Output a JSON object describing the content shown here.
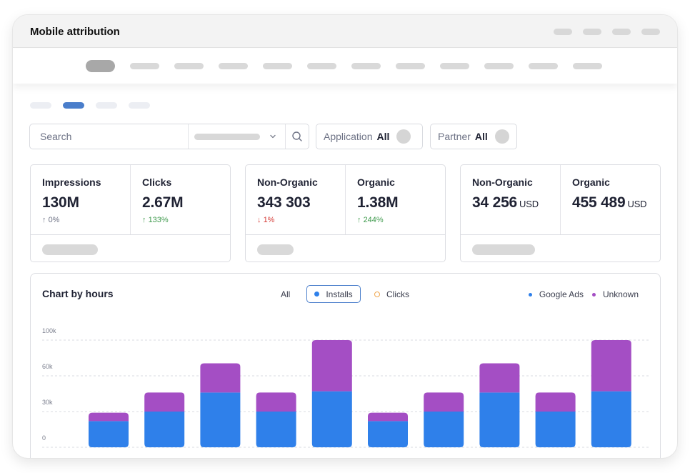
{
  "window": {
    "title": "Mobile attribution"
  },
  "search": {
    "placeholder": "Search"
  },
  "filters": [
    {
      "label": "Application",
      "value": "All"
    },
    {
      "label": "Partner",
      "value": "All"
    }
  ],
  "cards": [
    {
      "metrics": [
        {
          "label": "Impressions",
          "value": "130M",
          "unit": "",
          "delta": "0%",
          "direction": "neutral",
          "arrow": "↑"
        },
        {
          "label": "Clicks",
          "value": "2.67M",
          "unit": "",
          "delta": "133%",
          "direction": "up",
          "arrow": "↑"
        }
      ]
    },
    {
      "metrics": [
        {
          "label": "Non-Organic",
          "value": "343 303",
          "unit": "",
          "delta": "1%",
          "direction": "down",
          "arrow": "↓"
        },
        {
          "label": "Organic",
          "value": "1.38M",
          "unit": "",
          "delta": "244%",
          "direction": "up",
          "arrow": "↑"
        }
      ]
    },
    {
      "metrics": [
        {
          "label": "Non-Organic",
          "value": "34 256",
          "unit": "USD",
          "delta": "",
          "direction": "none",
          "arrow": ""
        },
        {
          "label": "Organic",
          "value": "455 489",
          "unit": "USD",
          "delta": "",
          "direction": "none",
          "arrow": ""
        }
      ]
    }
  ],
  "chart": {
    "title": "Chart by hours",
    "toggles": {
      "all": "All",
      "installs": "Installs",
      "clicks": "Clicks"
    },
    "legend": [
      {
        "label": "Google Ads",
        "color": "#2f80ea"
      },
      {
        "label": "Unknown",
        "color": "#a44ec4"
      }
    ]
  },
  "colors": {
    "accent": "#4a7ecb",
    "google_ads": "#2f80ea",
    "unknown": "#a44ec4",
    "clicks": "#f0a850",
    "up": "#3f9a4d",
    "down": "#d6403c"
  },
  "chart_data": {
    "type": "bar",
    "stacked": true,
    "title": "Chart by hours",
    "xlabel": "",
    "ylabel": "",
    "categories": [
      "",
      "",
      "",
      "",
      "",
      "",
      "",
      "",
      "",
      ""
    ],
    "yticks": [
      "0",
      "30k",
      "60k",
      "100k"
    ],
    "ytick_values": [
      0,
      30000,
      60000,
      100000
    ],
    "ylim": [
      0,
      100000
    ],
    "grid": true,
    "legend_position": "top-right",
    "series": [
      {
        "name": "Google Ads",
        "values": [
          22000,
          30000,
          46000,
          30000,
          47000,
          22000,
          30000,
          46000,
          30000,
          47000
        ]
      },
      {
        "name": "Unknown",
        "values": [
          7000,
          16000,
          28000,
          16000,
          53000,
          7000,
          16000,
          28000,
          16000,
          53000
        ]
      }
    ]
  }
}
